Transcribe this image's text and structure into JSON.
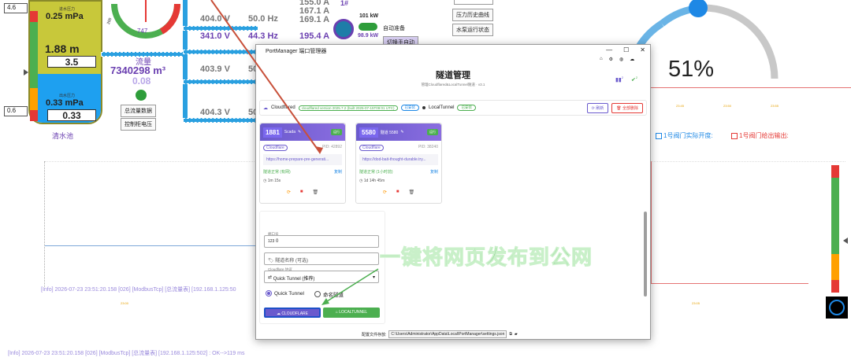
{
  "scada": {
    "left_top_value": "4.6",
    "left_mid_value": "0.6",
    "tank_top_label": "进水压力",
    "tank_top_pressure": "0.25 mPa",
    "tank_level": "1.88 m",
    "tank_level_box": "3.5",
    "tank_bottom_label": "出水压力",
    "tank_bottom_pressure": "0.33 mPa",
    "tank_bottom_box": "0.33",
    "tank_name": "清水池",
    "gauge_value": "747",
    "gauge_label": "200",
    "flow_label": "流量",
    "flow_value": "7340298 m³",
    "flow_sub": "0.08",
    "btn_total_flow": "总流量数据",
    "btn_control": "控制柜电压",
    "rows": [
      {
        "v": "404.0 V",
        "hz": "50.0 Hz",
        "a": "167.1 A"
      },
      {
        "v": "341.0 V",
        "hz": "44.3 Hz",
        "a": "195.4 A"
      },
      {
        "v": "403.9 V",
        "hz": "50",
        "a": ""
      },
      {
        "v": "404.3 V",
        "hz": "50",
        "a": ""
      }
    ],
    "top_amp": "155.0 A",
    "amp_169": "169.1 A",
    "pump_no": "1#",
    "kw_top": "101 kW",
    "kw_bottom": "98.9 kW",
    "auto_prep": "自动准备",
    "switch_manual": "切换手自动",
    "btn_pressure_hist": "压力历史曲线",
    "btn_pump_status": "水泵运行状态",
    "percent": "51%",
    "legend_actual": "1号阀门实际开度:",
    "legend_output": "1号阀门给出输出:",
    "log_line1": "[Info] 2026-07-23 23:51:20.158 [026] [ModbusTcp] [总流量表] [192.168.1.125:50",
    "log_line2": "[Info] 2026-07-23 23:51:20.158 [026] [ModbusTcp] [总流量表] [192.168.1.125:502] : OK-->119 ms",
    "time_labels": [
      "23:45",
      "23:50",
      "23:55",
      "23:00",
      "23:05"
    ],
    "overlay_caption": "一键将网页发布到公网"
  },
  "app": {
    "window_title": "PortManager 端口管理器",
    "header_title": "隧道管理",
    "header_sub": "管理Cloudflared&LocalTunnel隧道 · v3.1",
    "toolbar": {
      "cloudflared_label": "Cloudflared",
      "version_badge": "cloudflared version 2025.7.2 (built 2025-07-15T09:01 UTC)",
      "installed_badge": "已安装",
      "localtunnel_label": "LocalTunnel",
      "lt_badge": "已安装",
      "refresh": "刷新",
      "delete_all": "全部删除",
      "count_icon_badge": "2",
      "count_badge": "2"
    },
    "cards": [
      {
        "port": "1881",
        "name": "Scada",
        "status_badge": "运行",
        "provider": "Cloudflare",
        "pid": "PID: 42892",
        "url": "https://home-prepare-pre-generati...",
        "status": "隧道正常 (有网)",
        "status_action": "复制",
        "uptime": "1m 15s"
      },
      {
        "port": "5580",
        "name": "隧道 5580",
        "status_badge": "运行",
        "provider": "Cloudflare",
        "pid": "PID: 38240",
        "url": "https://dod-bait-thought-durable.try...",
        "status": "隧道正常 (1小时前)",
        "status_action": "复制",
        "uptime": "1d 14h 45m"
      }
    ],
    "form": {
      "port_label": "端口号",
      "port_value": "0",
      "name_placeholder": "隧道名称 (可选)",
      "provider_label": "Cloudflare 协议",
      "provider_value": "Quick Tunnel (推荐)",
      "radio_quick": "Quick Tunnel",
      "radio_named": "命名隧道",
      "btn_cloudflare": "CLOUDFLARE",
      "btn_localtunnel": "LOCALTUNNEL"
    },
    "statusbar_label": "配置文件存放:",
    "statusbar_path": "C:\\Users\\Administrator\\AppData\\Local\\PortManager\\settings.json"
  },
  "colors": {
    "accent": "#6a5acd",
    "green": "#4caf50",
    "red": "#e53935",
    "pipe": "#2aa0e0"
  }
}
